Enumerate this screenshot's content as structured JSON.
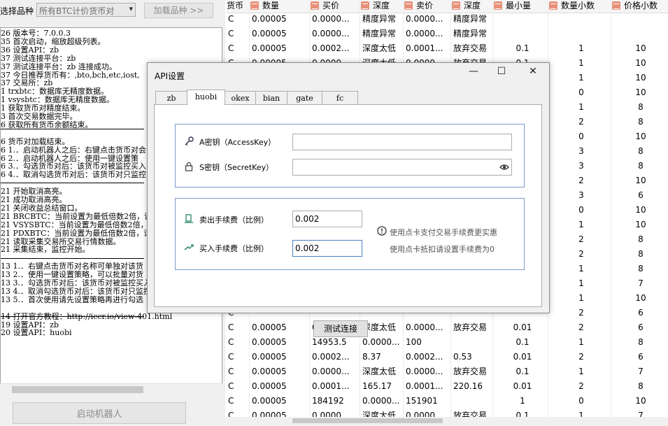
{
  "top_bar": {
    "select_label": "选择品种",
    "select_value": "所有BTC计价货币对",
    "load_button": "加载品种 >>"
  },
  "log_lines": [
    {
      "t": "26 版本号：7.0.0.3",
      "y": 0
    },
    {
      "t": "35 首次启动，缩放超级列表。",
      "y": 1
    },
    {
      "t": "36 设置API：zb",
      "y": 2
    },
    {
      "t": "37 测试连接平台：zb",
      "y": 3
    },
    {
      "t": "37 测试连接平台：zb  连接成功。",
      "y": 4
    },
    {
      "t": "37 今日推荐货币有：,bto,bch,etc,iost,",
      "y": 5
    },
    {
      "t": "37 交易所：zb",
      "y": 6
    },
    {
      "t": "1  trxbtc：数据库无精度数据。",
      "y": 7
    },
    {
      "t": "1  vsysbtc：数据库无精度数据。",
      "y": 8
    },
    {
      "t": "1  获取货币对精度结束。",
      "y": 9
    },
    {
      "t": "3  首次交易数据完毕。",
      "y": 10
    },
    {
      "t": "6  获取所有货币余额结束。",
      "y": 11
    },
    {
      "t": "6  货币对加载结束。",
      "y": 13
    },
    {
      "t": "6  1.．启动机器人之后：右键点击货币对会",
      "y": 14
    },
    {
      "t": "6  2.．启动机器人之后：使用一键设置策",
      "y": 15
    },
    {
      "t": "6  3.．勾选货币对后：该货币对被监控买入",
      "y": 16
    },
    {
      "t": "6  4.．取消勾选货币对后：该货币对只监控",
      "y": 17
    },
    {
      "t": "21 开始取消高亮。",
      "y": 19
    },
    {
      "t": "21 成功取消高亮。",
      "y": 20
    },
    {
      "t": "21 关闭收益总结窗口。",
      "y": 21
    },
    {
      "t": "21 BRCBTC：当前设置为最低倍数2倍，请重",
      "y": 22
    },
    {
      "t": "21 VSYSBTC：当前设置为最低倍数2倍，请重",
      "y": 23
    },
    {
      "t": "21 PDXBTC：当前设置为最低倍数2倍，请重",
      "y": 24
    },
    {
      "t": "21 读取采集交易所交易行情数据。",
      "y": 25
    },
    {
      "t": "21 采集结束，监控开始。",
      "y": 26
    },
    {
      "t": "13 1.．右键点击货币对名称可单独对该货",
      "y": 28
    },
    {
      "t": "13 2.．使用一键设置策略，可以批量对货",
      "y": 29
    },
    {
      "t": "13 3.．勾选货币对后：该货币对被监控买入",
      "y": 30
    },
    {
      "t": "13 4.．取消勾选货币对后：该货币对只监控",
      "y": 31
    },
    {
      "t": "13 5.．首次使用请先设置策略再进行勾选",
      "y": 32
    },
    {
      "t": "14 打开官方教程：http://iccr.io/view-401.html",
      "y": 34
    },
    {
      "t": "19 设置API：zb",
      "y": 35
    },
    {
      "t": "20 设置API：huobi",
      "y": 36
    }
  ],
  "start_button": "启动机器人",
  "grid": {
    "headers": [
      "货币",
      "数量",
      "买价",
      "深度",
      "卖价",
      "深度",
      "最小量",
      "数量小数",
      "价格小数"
    ],
    "rows": [
      [
        "C",
        "0.00005",
        "0.0000...",
        "精度异常",
        "0.0000...",
        "精度异常",
        "",
        "",
        ""
      ],
      [
        "C",
        "0.00005",
        "0.0000...",
        "精度异常",
        "0.0000...",
        "精度异常",
        "",
        "",
        ""
      ],
      [
        "C",
        "0.00005",
        "0.0002...",
        "深度太低",
        "0.0001...",
        "放弃交易",
        "0.1",
        "1",
        "10"
      ],
      [
        "C",
        "0.00005",
        "0.0000...",
        "深度太低",
        "0.0000...",
        "放弃交易",
        "0.1",
        "1",
        "10"
      ],
      [
        "C",
        "",
        "",
        "",
        "",
        "",
        "",
        "1",
        "10"
      ],
      [
        "C",
        "",
        "",
        "",
        "",
        "",
        "",
        "0",
        "10"
      ],
      [
        "C",
        "",
        "",
        "",
        "",
        "",
        "",
        "1",
        "8"
      ],
      [
        "C",
        "",
        "",
        "",
        "",
        "",
        "",
        "2",
        "8"
      ],
      [
        "C",
        "",
        "",
        "",
        "",
        "",
        "",
        "0",
        "10"
      ],
      [
        "C",
        "",
        "",
        "",
        "",
        "",
        "",
        "3",
        "8"
      ],
      [
        "C",
        "",
        "",
        "",
        "",
        "",
        "",
        "3",
        "8"
      ],
      [
        "C",
        "",
        "",
        "",
        "",
        "",
        "",
        "2",
        "10"
      ],
      [
        "C",
        "",
        "",
        "",
        "",
        "",
        "",
        "3",
        "6"
      ],
      [
        "C",
        "",
        "",
        "",
        "",
        "",
        "",
        "0",
        "10"
      ],
      [
        "C",
        "",
        "",
        "",
        "",
        "",
        "",
        "1",
        "10"
      ],
      [
        "C",
        "",
        "",
        "",
        "",
        "",
        "",
        "2",
        "8"
      ],
      [
        "C",
        "",
        "",
        "",
        "",
        "",
        "",
        "2",
        "8"
      ],
      [
        "C",
        "",
        "",
        "",
        "",
        "",
        "",
        "1",
        "8"
      ],
      [
        "C",
        "",
        "",
        "",
        "",
        "",
        "",
        "1",
        "7"
      ],
      [
        "C",
        "",
        "",
        "",
        "",
        "",
        "",
        "1",
        "10"
      ],
      [
        "C",
        "",
        "",
        "",
        "",
        "",
        "",
        "2",
        "6"
      ],
      [
        "C",
        "0.00005",
        "0.0000...",
        "深度太低",
        "0.0000...",
        "放弃交易",
        "0.01",
        "2",
        "6"
      ],
      [
        "C",
        "0.00005",
        "14953.5",
        "0.0000...",
        "100",
        "",
        "0.1",
        "1",
        "8"
      ],
      [
        "C",
        "0.00005",
        "0.0002...",
        "8.37",
        "0.0002...",
        "0.53",
        "0.01",
        "2",
        "6"
      ],
      [
        "C",
        "0.00005",
        "0.0000...",
        "深度太低",
        "0.0000...",
        "放弃交易",
        "0.1",
        "1",
        "7"
      ],
      [
        "C",
        "0.00005",
        "0.0001...",
        "165.17",
        "0.0001...",
        "220.16",
        "0.01",
        "2",
        "8"
      ],
      [
        "C",
        "0.00005",
        "184192",
        "0.0000...",
        "151901",
        "",
        "1",
        "0",
        "10"
      ],
      [
        "C",
        "0.00005",
        "0.0000...",
        "深度太低",
        "0.0000...",
        "放弃交易",
        "0.1",
        "1",
        "7"
      ]
    ]
  },
  "dialog": {
    "title": "API设置",
    "min_glyph": "—",
    "max_glyph": "☐",
    "close_glyph": "✕",
    "tabs": [
      "zb",
      "huobi",
      "okex",
      "bian",
      "gate",
      "fc"
    ],
    "active_tab": "huobi",
    "access_key_label": "A密钥（AccessKey）",
    "access_key_value": "",
    "secret_key_label": "S密钥（SecretKey）",
    "secret_key_value": "",
    "sell_fee_label": "卖出手续费（比例）",
    "sell_fee_value": "0.002",
    "buy_fee_label": "买入手续费（比例）",
    "buy_fee_value": "0.002",
    "note_line1": "使用点卡支付交易手续费更实惠",
    "note_line2": "使用点卡抵扣请设置手续费为0",
    "test_button": "测试连接"
  },
  "colors": {
    "group_border": "#7a9cc8",
    "header_icon": "#e8907a",
    "input_focus": "#4a7fc1"
  }
}
